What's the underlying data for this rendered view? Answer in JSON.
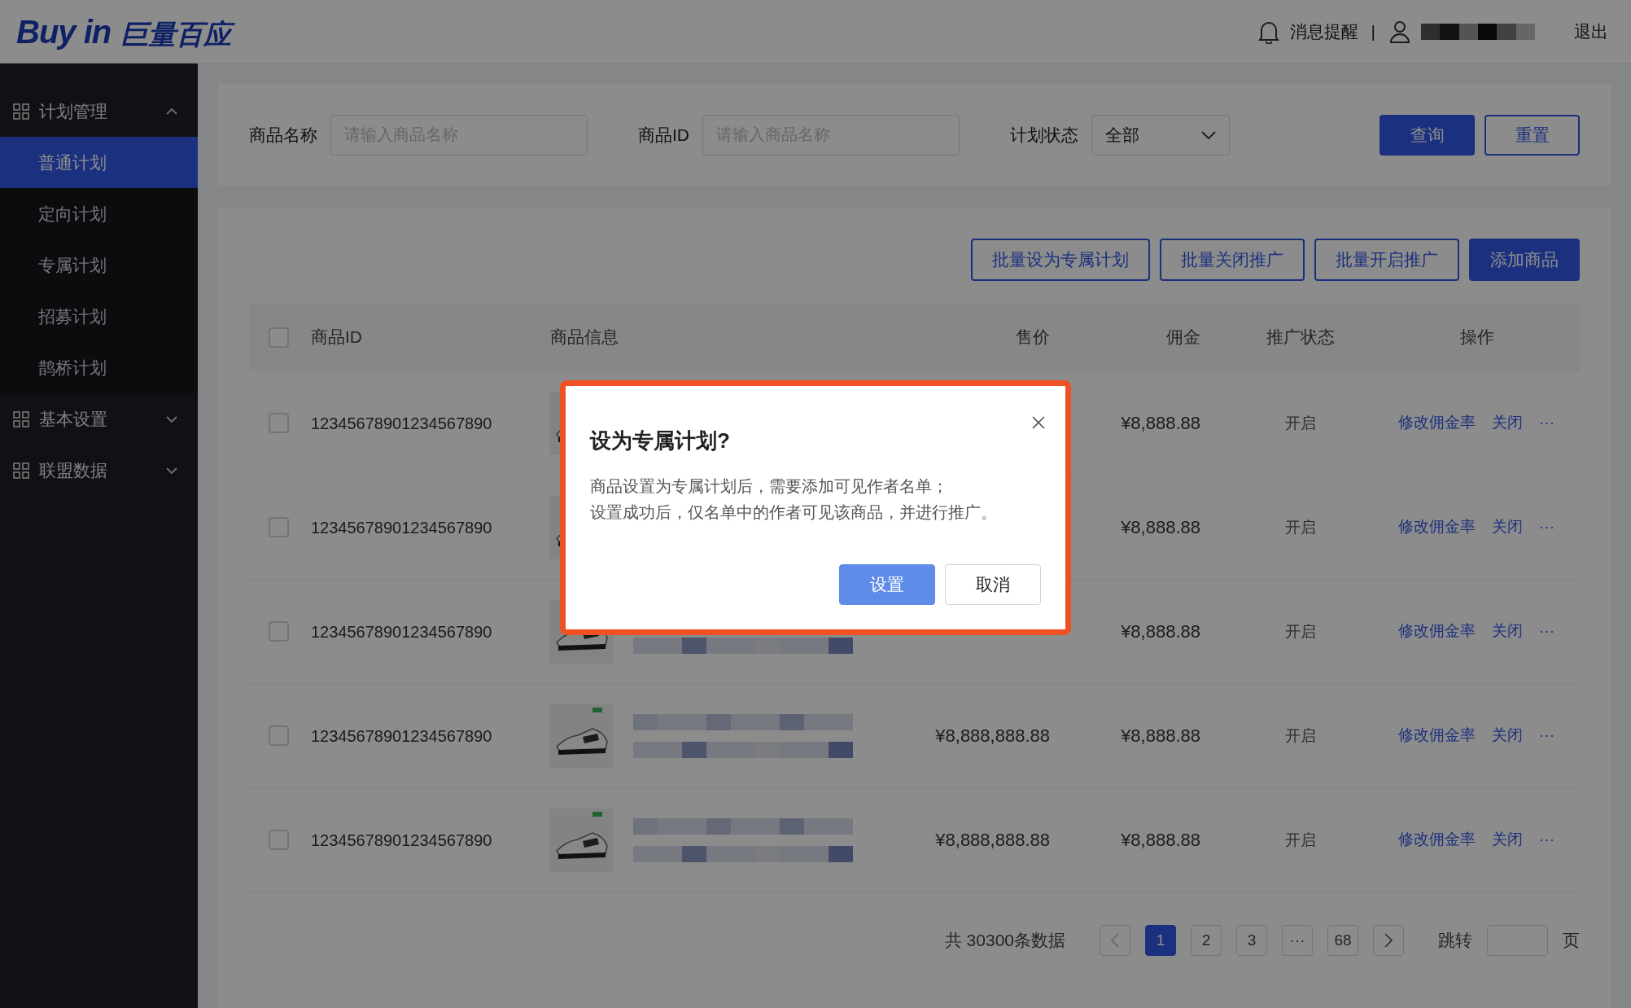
{
  "header": {
    "logo_latin": "Buy in",
    "logo_cn": "巨量百应",
    "notice": "消息提醒",
    "separator": "|",
    "logout": "退出"
  },
  "sidebar": {
    "groups": [
      {
        "label": "计划管理",
        "expanded": true,
        "children": [
          {
            "label": "普通计划",
            "selected": true
          },
          {
            "label": "定向计划",
            "selected": false
          },
          {
            "label": "专属计划",
            "selected": false
          },
          {
            "label": "招募计划",
            "selected": false
          },
          {
            "label": "鹊桥计划",
            "selected": false
          }
        ]
      },
      {
        "label": "基本设置",
        "expanded": false
      },
      {
        "label": "联盟数据",
        "expanded": false
      }
    ]
  },
  "filters": {
    "fields": [
      {
        "label": "商品名称",
        "placeholder": "请输入商品名称"
      },
      {
        "label": "商品ID",
        "placeholder": "请输入商品名称"
      }
    ],
    "select": {
      "label": "计划状态",
      "value": "全部"
    },
    "buttons": [
      {
        "label": "查询",
        "kind": "primary"
      },
      {
        "label": "重置",
        "kind": "outline"
      }
    ]
  },
  "toolbar": [
    {
      "label": "批量设为专属计划",
      "kind": "outline"
    },
    {
      "label": "批量关闭推广",
      "kind": "outline"
    },
    {
      "label": "批量开启推广",
      "kind": "outline"
    },
    {
      "label": "添加商品",
      "kind": "primary"
    }
  ],
  "table": {
    "columns": [
      "商品ID",
      "商品信息",
      "售价",
      "佣金",
      "推广状态",
      "操作"
    ],
    "header_checked": false,
    "rows": [
      {
        "checked": false,
        "id": "12345678901234567890",
        "commission": "¥8,888.88",
        "status": "开启",
        "actions": [
          "修改佣金率",
          "关闭",
          "···"
        ]
      },
      {
        "checked": false,
        "id": "12345678901234567890",
        "commission": "¥8,888.88",
        "status": "开启",
        "actions": [
          "修改佣金率",
          "关闭",
          "···"
        ]
      },
      {
        "checked": false,
        "product_info": {
          "kind": "redacted"
        },
        "id": "12345678901234567890",
        "commission": "¥8,888.88",
        "status": "开启",
        "actions": [
          "修改佣金率",
          "关闭",
          "···"
        ]
      },
      {
        "checked": false,
        "product_info": {
          "kind": "redacted"
        },
        "id": "12345678901234567890",
        "price": "¥8,888,888.88",
        "commission": "¥8,888.88",
        "status": "开启",
        "actions": [
          "修改佣金率",
          "关闭",
          "···"
        ]
      },
      {
        "checked": false,
        "product_info": {
          "kind": "redacted"
        },
        "id": "12345678901234567890",
        "price": "¥8,888,888.88",
        "commission": "¥8,888.88",
        "status": "开启",
        "actions": [
          "修改佣金率",
          "关闭",
          "···"
        ]
      }
    ]
  },
  "pagination": {
    "total": "共 30300条数据",
    "pages": [
      {
        "label": "1",
        "selected": true
      },
      {
        "label": "2",
        "selected": false
      },
      {
        "label": "3",
        "selected": false
      },
      {
        "label": "···",
        "selected": false
      },
      {
        "label": "68",
        "selected": false
      }
    ],
    "jump_label": "跳转",
    "page_suffix": "页"
  },
  "modal": {
    "title": "设为专属计划?",
    "lines": [
      "商品设置为专属计划后，需要添加可见作者名单；",
      "设置成功后，仅名单中的作者可见该商品，并进行推广。"
    ],
    "highlighted": true,
    "buttons": [
      {
        "label": "设置",
        "kind": "primary"
      },
      {
        "label": "取消",
        "kind": "outline"
      }
    ]
  }
}
